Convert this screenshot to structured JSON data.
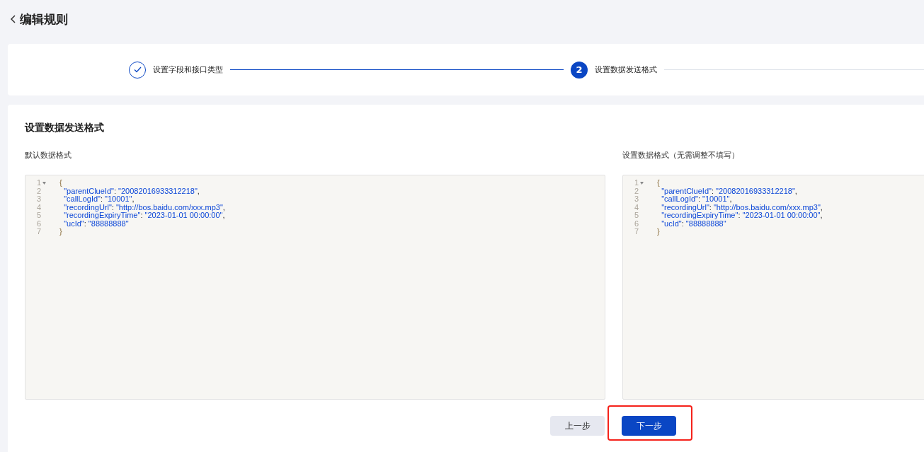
{
  "header": {
    "title": "编辑规则"
  },
  "steps": [
    {
      "label": "设置字段和接口类型",
      "completed": true,
      "selected": false
    },
    {
      "number": "2",
      "label": "设置数据发送格式",
      "completed": false,
      "selected": true
    }
  ],
  "section": {
    "title": "设置数据发送格式"
  },
  "editors": [
    {
      "label": "默认数据格式",
      "lines": [
        {
          "number": "1",
          "foldable": true,
          "text": "{"
        },
        {
          "number": "2",
          "foldable": false,
          "text": "  \"parentClueId\": \"20082016933312218\","
        },
        {
          "number": "3",
          "foldable": false,
          "text": "  \"callLogId\": \"10001\","
        },
        {
          "number": "4",
          "foldable": false,
          "text": "  \"recordingUrl\": \"http://bos.baidu.com/xxx.mp3\","
        },
        {
          "number": "5",
          "foldable": false,
          "text": "  \"recordingExpiryTime\": \"2023-01-01 00:00:00\","
        },
        {
          "number": "6",
          "foldable": false,
          "text": "  \"ucId\": \"88888888\""
        },
        {
          "number": "7",
          "foldable": false,
          "text": "}"
        }
      ]
    },
    {
      "label": "设置数据格式（无需调整不填写）",
      "lines": [
        {
          "number": "1",
          "foldable": true,
          "text": "{"
        },
        {
          "number": "2",
          "foldable": false,
          "text": "  \"parentClueId\": \"20082016933312218\","
        },
        {
          "number": "3",
          "foldable": false,
          "text": "  \"callLogId\": \"10001\","
        },
        {
          "number": "4",
          "foldable": false,
          "text": "  \"recordingUrl\": \"http://bos.baidu.com/xxx.mp3\","
        },
        {
          "number": "5",
          "foldable": false,
          "text": "  \"recordingExpiryTime\": \"2023-01-01 00:00:00\","
        },
        {
          "number": "6",
          "foldable": false,
          "text": "  \"ucId\": \"88888888\""
        },
        {
          "number": "7",
          "foldable": false,
          "text": "}"
        }
      ]
    }
  ],
  "buttons": [
    {
      "label": "上一步",
      "kind": "secondary",
      "highlighted": false
    },
    {
      "label": "下一步",
      "kind": "primary",
      "highlighted": true
    }
  ]
}
